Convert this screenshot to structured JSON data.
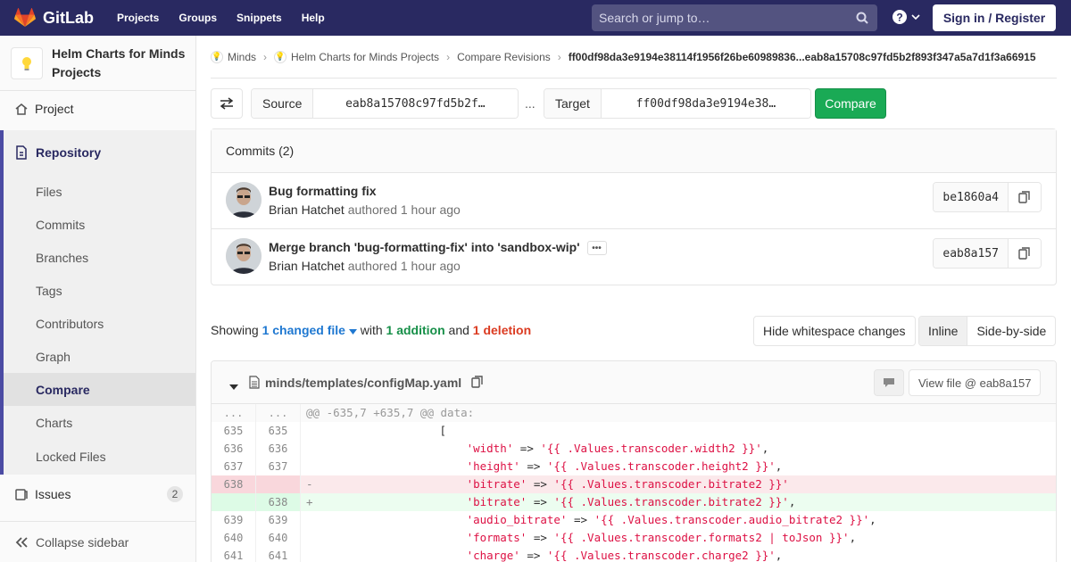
{
  "navbar": {
    "brand": "GitLab",
    "links": [
      "Projects",
      "Groups",
      "Snippets",
      "Help"
    ],
    "search_placeholder": "Search or jump to…",
    "signin": "Sign in / Register"
  },
  "sidebar": {
    "project_name": "Helm Charts for Minds Projects",
    "project_item": "Project",
    "repository": "Repository",
    "repo_items": [
      "Files",
      "Commits",
      "Branches",
      "Tags",
      "Contributors",
      "Graph",
      "Compare",
      "Charts",
      "Locked Files"
    ],
    "active_item": "Compare",
    "issues": "Issues",
    "issues_count": "2",
    "collapse": "Collapse sidebar"
  },
  "breadcrumbs": {
    "group": "Minds",
    "project": "Helm Charts for Minds Projects",
    "section": "Compare Revisions",
    "current": "ff00df98da3e9194e38114f1956f26be60989836...eab8a15708c97fd5b2f893f347a5a7d1f3a66915"
  },
  "compare": {
    "source_label": "Source",
    "source_value": "eab8a15708c97fd5b2f…",
    "separator": "...",
    "target_label": "Target",
    "target_value": "ff00df98da3e9194e38…",
    "button": "Compare"
  },
  "commits": {
    "header": "Commits (2)",
    "items": [
      {
        "title": "Bug formatting fix",
        "author": "Brian Hatchet",
        "meta": "authored 1 hour ago",
        "sha": "be1860a4"
      },
      {
        "title": "Merge branch 'bug-formatting-fix' into 'sandbox-wip'",
        "author": "Brian Hatchet",
        "meta": "authored 1 hour ago",
        "sha": "eab8a157"
      }
    ]
  },
  "stats": {
    "showing": "Showing",
    "changed": "1 changed file",
    "with": "with",
    "additions": "1 addition",
    "and": "and",
    "deletions": "1 deletion",
    "whitespace_btn": "Hide whitespace changes",
    "inline": "Inline",
    "side_by_side": "Side-by-side"
  },
  "file": {
    "path": "minds/templates/configMap.yaml",
    "view_file": "View file @ eab8a157"
  },
  "diff": [
    {
      "type": "hunk",
      "old": "...",
      "new": "...",
      "code": "@@ -635,7 +635,7 @@ data:"
    },
    {
      "type": "ctx",
      "old": "635",
      "new": "635",
      "code": "                  ["
    },
    {
      "type": "ctx",
      "old": "636",
      "new": "636",
      "code": "                      'width' => '{{ .Values.transcoder.width2 }}',"
    },
    {
      "type": "ctx",
      "old": "637",
      "new": "637",
      "code": "                      'height' => '{{ .Values.transcoder.height2 }}',"
    },
    {
      "type": "del",
      "old": "638",
      "new": "",
      "code": "                      'bitrate' => '{{ .Values.transcoder.bitrate2 }}'"
    },
    {
      "type": "add",
      "old": "",
      "new": "638",
      "code": "                      'bitrate' => '{{ .Values.transcoder.bitrate2 }}',"
    },
    {
      "type": "ctx",
      "old": "639",
      "new": "639",
      "code": "                      'audio_bitrate' => '{{ .Values.transcoder.audio_bitrate2 }}',"
    },
    {
      "type": "ctx",
      "old": "640",
      "new": "640",
      "code": "                      'formats' => '{{ .Values.transcoder.formats2 | toJson }}',"
    },
    {
      "type": "ctx",
      "old": "641",
      "new": "641",
      "code": "                      'charge' => '{{ .Values.transcoder.charge2 }}',"
    }
  ],
  "colors": {
    "navbar": "#292961",
    "accent": "#4b4ba3",
    "compare": "#1aaa55",
    "addition": "#168f48",
    "deletion": "#db3b21"
  }
}
